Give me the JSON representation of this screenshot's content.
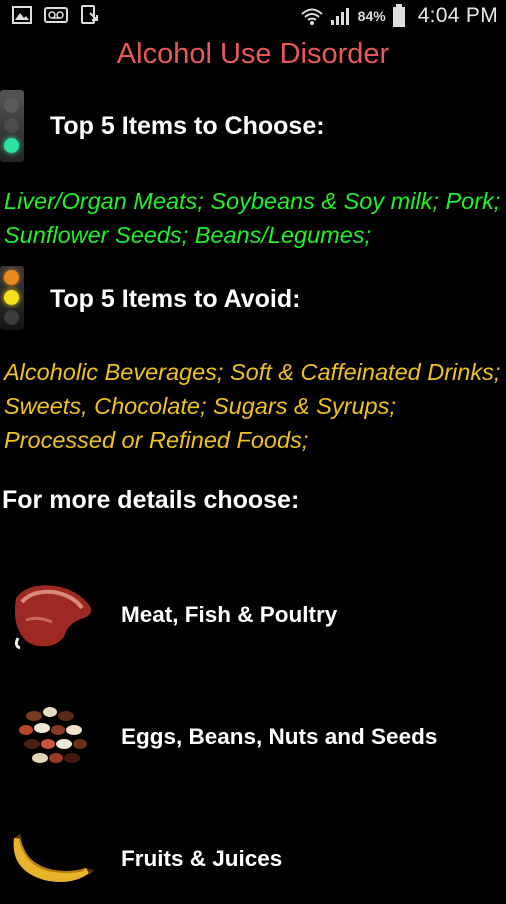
{
  "status": {
    "battery_pct": "84%",
    "time": "4:04 PM"
  },
  "title": "Alcohol Use Disorder",
  "choose": {
    "heading": "Top 5 Items to Choose:",
    "text": "Liver/Organ Meats; Soybeans & Soy milk; Pork; Sunflower Seeds; Beans/Legumes;",
    "color": "#22ef2a"
  },
  "avoid": {
    "heading": "Top 5 Items to Avoid:",
    "text": "Alcoholic Beverages; Soft & Caffeinated Drinks; Sweets, Chocolate; Sugars & Syrups; Processed or Refined Foods;",
    "color": "#f0c21d"
  },
  "more_details": "For more details choose:",
  "categories": [
    {
      "label": "Meat, Fish & Poultry",
      "icon": "meat-icon"
    },
    {
      "label": "Eggs, Beans, Nuts and Seeds",
      "icon": "beans-icon"
    },
    {
      "label": "Fruits & Juices",
      "icon": "banana-icon"
    }
  ],
  "colors": {
    "title": "#e8575a",
    "background": "#000000"
  }
}
